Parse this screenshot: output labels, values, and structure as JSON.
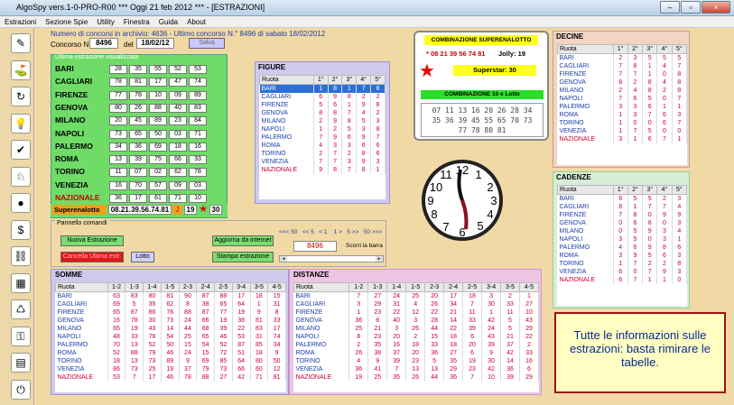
{
  "title": "AlgoSpy vers.1-0-PRO-R00  ***  Oggi 21 feb 2012  ***  - [ESTRAZIONI]",
  "window_controls": {
    "minimize": "–",
    "restore": "▫",
    "close": "×"
  },
  "menu": [
    "Estrazioni",
    "Sezione Spie",
    "Utility",
    "Finestra",
    "Guida",
    "About"
  ],
  "info_line": "Numero di concorsi in archivio: 4636   -   Ultimo concorso N.° 8496 di sabato 18/02/2012",
  "concorso": {
    "label": "Concorso N.°",
    "number": "8496",
    "del": "del",
    "date": "18/02/12",
    "button": "Salva"
  },
  "green_panel_title": "Ultima estrazione visualizzata",
  "ruote": [
    {
      "name": "BARI",
      "nums": [
        "28",
        "35",
        "55",
        "52",
        "53"
      ]
    },
    {
      "name": "CAGLIARI",
      "nums": [
        "78",
        "81",
        "17",
        "47",
        "74"
      ]
    },
    {
      "name": "FIRENZE",
      "nums": [
        "77",
        "78",
        "10",
        "09",
        "89"
      ]
    },
    {
      "name": "GENOVA",
      "nums": [
        "80",
        "26",
        "88",
        "40",
        "83"
      ]
    },
    {
      "name": "MILANO",
      "nums": [
        "20",
        "45",
        "89",
        "23",
        "84"
      ]
    },
    {
      "name": "NAPOLI",
      "nums": [
        "73",
        "65",
        "50",
        "03",
        "71"
      ]
    },
    {
      "name": "PALERMO",
      "nums": [
        "34",
        "36",
        "69",
        "18",
        "16"
      ]
    },
    {
      "name": "ROMA",
      "nums": [
        "13",
        "39",
        "75",
        "66",
        "33"
      ]
    },
    {
      "name": "TORINO",
      "nums": [
        "11",
        "07",
        "02",
        "62",
        "78"
      ]
    },
    {
      "name": "VENEZIA",
      "nums": [
        "16",
        "70",
        "57",
        "09",
        "03"
      ]
    },
    {
      "name": "NAZIONALE",
      "nums": [
        "36",
        "17",
        "61",
        "71",
        "10"
      ]
    }
  ],
  "superenalotto": {
    "label": "Superenalotto",
    "combo": "08.21.39.56.74.81",
    "jolly": "19",
    "star": "30",
    "jolly_glyph": "J",
    "star_glyph": "★"
  },
  "comb_box": {
    "title": "COMBINAZIONE SUPERENALOTTO",
    "combo": "* 08 21 39 56 74 81",
    "jolly": "Jolly: 19",
    "superstar": "Superstar: 30",
    "title10": "COMBINAZIONE 10 e Lotto",
    "lotto10": [
      [
        "07",
        "11",
        "13",
        "16",
        "20",
        "26",
        "28",
        "34"
      ],
      [
        "35",
        "36",
        "39",
        "45",
        "55",
        "65",
        "70",
        "73"
      ],
      [
        "77",
        "78",
        "80",
        "81"
      ]
    ]
  },
  "figure": {
    "title": "FIGURE",
    "headers": [
      "Ruota",
      "1°",
      "2°",
      "3°",
      "4°",
      "5°"
    ],
    "rows": [
      [
        "BARI",
        "1",
        "8",
        "1",
        "7",
        "8"
      ],
      [
        "CAGLIARI",
        "6",
        "9",
        "8",
        "2",
        "2"
      ],
      [
        "FIRENZE",
        "5",
        "6",
        "1",
        "9",
        "8"
      ],
      [
        "GENOVA",
        "8",
        "8",
        "7",
        "4",
        "2"
      ],
      [
        "MILANO",
        "2",
        "9",
        "8",
        "5",
        "3"
      ],
      [
        "NAPOLI",
        "1",
        "2",
        "5",
        "3",
        "8"
      ],
      [
        "PALERMO",
        "7",
        "9",
        "6",
        "9",
        "7"
      ],
      [
        "ROMA",
        "4",
        "3",
        "3",
        "6",
        "6"
      ],
      [
        "TORINO",
        "2",
        "7",
        "2",
        "8",
        "6"
      ],
      [
        "VENEZIA",
        "7",
        "7",
        "3",
        "9",
        "3"
      ],
      [
        "NAZIONALE",
        "9",
        "8",
        "7",
        "8",
        "1"
      ]
    ]
  },
  "decine": {
    "title": "DECINE",
    "headers": [
      "Ruota",
      "1°",
      "2°",
      "3°",
      "4°",
      "5°"
    ],
    "rows": [
      [
        "BARI",
        "2",
        "3",
        "5",
        "5",
        "5"
      ],
      [
        "CAGLIARI",
        "7",
        "8",
        "1",
        "4",
        "7"
      ],
      [
        "FIRENZE",
        "7",
        "7",
        "1",
        "0",
        "8"
      ],
      [
        "GENOVA",
        "8",
        "2",
        "8",
        "4",
        "8"
      ],
      [
        "MILANO",
        "2",
        "4",
        "8",
        "2",
        "8"
      ],
      [
        "NAPOLI",
        "7",
        "6",
        "5",
        "0",
        "7"
      ],
      [
        "PALERMO",
        "3",
        "3",
        "6",
        "1",
        "1"
      ],
      [
        "ROMA",
        "1",
        "3",
        "7",
        "6",
        "3"
      ],
      [
        "TORINO",
        "1",
        "0",
        "0",
        "6",
        "7"
      ],
      [
        "VENEZIA",
        "1",
        "7",
        "5",
        "0",
        "0"
      ],
      [
        "NAZIONALE",
        "3",
        "1",
        "6",
        "7",
        "1"
      ]
    ]
  },
  "cadenze": {
    "title": "CADENZE",
    "headers": [
      "Ruota",
      "1°",
      "2°",
      "3°",
      "4°",
      "5°"
    ],
    "rows": [
      [
        "BARI",
        "8",
        "5",
        "5",
        "2",
        "3"
      ],
      [
        "CAGLIARI",
        "8",
        "1",
        "7",
        "7",
        "4"
      ],
      [
        "FIRENZE",
        "7",
        "8",
        "0",
        "9",
        "9"
      ],
      [
        "GENOVA",
        "0",
        "6",
        "8",
        "0",
        "3"
      ],
      [
        "MILANO",
        "0",
        "5",
        "9",
        "3",
        "4"
      ],
      [
        "NAPOLI",
        "3",
        "5",
        "0",
        "3",
        "1"
      ],
      [
        "PALERMO",
        "4",
        "6",
        "9",
        "8",
        "6"
      ],
      [
        "ROMA",
        "3",
        "9",
        "5",
        "6",
        "3"
      ],
      [
        "TORINO",
        "1",
        "7",
        "2",
        "2",
        "8"
      ],
      [
        "VENEZIA",
        "6",
        "0",
        "7",
        "9",
        "3"
      ],
      [
        "NAZIONALE",
        "6",
        "7",
        "1",
        "1",
        "0"
      ]
    ]
  },
  "pannello": {
    "title": "Pannello comandi",
    "nuova": "Nuova Estrazione",
    "cancella": "Cancella Ultima estr.",
    "lotto": "Lotto",
    "aggiorna": "Aggiorna da internet",
    "stampa": "Stampa estrazione",
    "nav": "<<< 50   << 5   < 1    1 >   5 >>   50 >>>",
    "concorso": "8496",
    "scorri": "Scorri la barra",
    "scroll_left": "◂",
    "scroll_right": "▸"
  },
  "somme": {
    "title": "SOMME",
    "headers": [
      "Ruota",
      "1-2",
      "1-3",
      "1-4",
      "1-5",
      "2-3",
      "2-4",
      "2-5",
      "3-4",
      "3-5",
      "4-5"
    ],
    "rows": [
      [
        "BARI",
        "63",
        "83",
        "80",
        "81",
        "90",
        "87",
        "88",
        "17",
        "18",
        "15"
      ],
      [
        "CAGLIARI",
        "69",
        "5",
        "35",
        "62",
        "8",
        "38",
        "65",
        "64",
        "1",
        "31"
      ],
      [
        "FIRENZE",
        "65",
        "87",
        "86",
        "76",
        "88",
        "87",
        "77",
        "19",
        "9",
        "8"
      ],
      [
        "GENOVA",
        "16",
        "78",
        "30",
        "73",
        "24",
        "66",
        "19",
        "38",
        "81",
        "33"
      ],
      [
        "MILANO",
        "65",
        "19",
        "43",
        "14",
        "44",
        "68",
        "39",
        "22",
        "83",
        "17"
      ],
      [
        "NAPOLI",
        "48",
        "33",
        "76",
        "54",
        "25",
        "65",
        "46",
        "53",
        "31",
        "74"
      ],
      [
        "PALERMO",
        "70",
        "13",
        "52",
        "50",
        "15",
        "54",
        "52",
        "87",
        "85",
        "34"
      ],
      [
        "ROMA",
        "52",
        "88",
        "79",
        "46",
        "24",
        "15",
        "72",
        "51",
        "18",
        "9"
      ],
      [
        "TORINO",
        "18",
        "13",
        "73",
        "89",
        "9",
        "69",
        "85",
        "64",
        "80",
        "50"
      ],
      [
        "VENEZIA",
        "86",
        "73",
        "25",
        "19",
        "37",
        "79",
        "73",
        "66",
        "60",
        "12"
      ],
      [
        "NAZIONALE",
        "53",
        "7",
        "17",
        "46",
        "78",
        "88",
        "27",
        "42",
        "71",
        "81"
      ]
    ]
  },
  "distanze": {
    "title": "DISTANZE",
    "headers": [
      "Ruota",
      "1-2",
      "1-3",
      "1-4",
      "1-5",
      "2-3",
      "2-4",
      "2-5",
      "3-4",
      "3-5",
      "4-5"
    ],
    "rows": [
      [
        "BARI",
        "7",
        "27",
        "24",
        "25",
        "20",
        "17",
        "18",
        "3",
        "2",
        "1"
      ],
      [
        "CAGLIARI",
        "3",
        "29",
        "31",
        "4",
        "26",
        "34",
        "7",
        "30",
        "33",
        "27"
      ],
      [
        "FIRENZE",
        "1",
        "23",
        "22",
        "12",
        "22",
        "21",
        "11",
        "1",
        "11",
        "10"
      ],
      [
        "GENOVA",
        "36",
        "8",
        "40",
        "3",
        "28",
        "14",
        "33",
        "42",
        "5",
        "43"
      ],
      [
        "MILANO",
        "25",
        "21",
        "3",
        "26",
        "44",
        "22",
        "39",
        "24",
        "5",
        "29"
      ],
      [
        "NAPOLI",
        "8",
        "23",
        "20",
        "2",
        "15",
        "18",
        "6",
        "43",
        "21",
        "22"
      ],
      [
        "PALERMO",
        "2",
        "35",
        "16",
        "18",
        "33",
        "18",
        "20",
        "39",
        "37",
        "2"
      ],
      [
        "ROMA",
        "26",
        "38",
        "37",
        "20",
        "36",
        "27",
        "6",
        "9",
        "42",
        "33"
      ],
      [
        "TORINO",
        "4",
        "9",
        "39",
        "23",
        "5",
        "35",
        "19",
        "30",
        "14",
        "16"
      ],
      [
        "VENEZIA",
        "36",
        "41",
        "7",
        "13",
        "13",
        "29",
        "23",
        "42",
        "36",
        "6"
      ],
      [
        "NAZIONALE",
        "19",
        "25",
        "35",
        "26",
        "44",
        "36",
        "7",
        "10",
        "39",
        "29"
      ]
    ]
  },
  "note": "Tutte le informazioni sulle estrazioni: basta rimirare le tabelle.",
  "toolbar_icons": [
    "pen-icon",
    "lottery-icon",
    "refresh-icon",
    "bulb-icon",
    "check-icon",
    "spy-icon",
    "ball-icon",
    "money-icon",
    "network-icon",
    "window-icon",
    "recycle-icon",
    "lock-icon",
    "book-icon",
    "power-icon"
  ]
}
